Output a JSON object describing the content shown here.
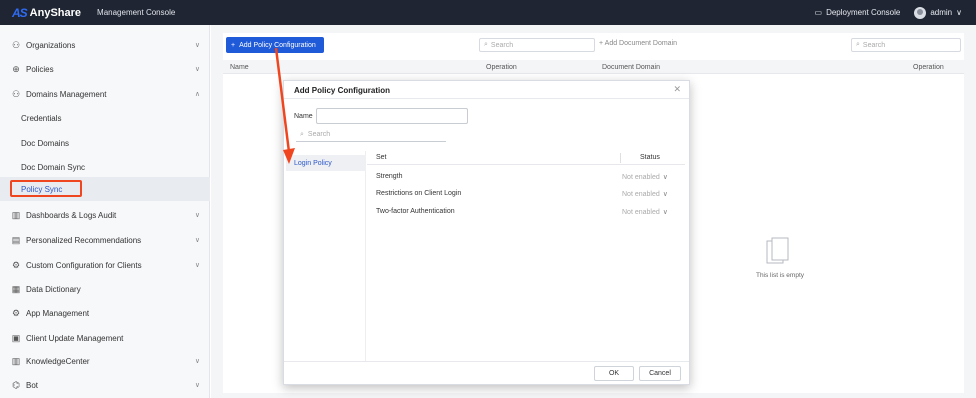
{
  "topbar": {
    "logo_mark": "AS",
    "logo_text": "AnyShare",
    "title": "Management Console",
    "deployment": "Deployment Console",
    "user": "admin"
  },
  "sidebar": {
    "items": [
      {
        "label": "Organizations",
        "icon": "org-icon",
        "chevron": "∨"
      },
      {
        "label": "Policies",
        "icon": "policy-icon",
        "chevron": "∨"
      },
      {
        "label": "Domains Management",
        "icon": "domains-icon",
        "chevron": "∧"
      },
      {
        "label": "Credentials"
      },
      {
        "label": "Doc Domains"
      },
      {
        "label": "Doc Domain Sync"
      },
      {
        "label": "Policy Sync"
      },
      {
        "label": "Dashboards & Logs Audit",
        "icon": "dashboard-icon",
        "chevron": "∨"
      },
      {
        "label": "Personalized Recommendations",
        "icon": "recommend-icon",
        "chevron": "∨"
      },
      {
        "label": "Custom Configuration for Clients",
        "icon": "custom-icon",
        "chevron": "∨"
      },
      {
        "label": "Data Dictionary",
        "icon": "dictionary-icon"
      },
      {
        "label": "App Management",
        "icon": "app-icon"
      },
      {
        "label": "Client Update Management",
        "icon": "update-icon"
      },
      {
        "label": "KnowledgeCenter",
        "icon": "knowledge-icon",
        "chevron": "∨"
      },
      {
        "label": "Bot",
        "icon": "bot-icon",
        "chevron": "∨"
      }
    ]
  },
  "main": {
    "add_policy_button": "Add Policy Configuration",
    "search_placeholder": "Search",
    "add_domain": "Add Document Domain",
    "left_columns": [
      "Name",
      "Operation"
    ],
    "right_columns": [
      "Document Domain",
      "Operation"
    ],
    "empty_text": "This list is empty"
  },
  "dialog": {
    "title": "Add Policy Configuration",
    "name_label": "Name",
    "name_value": "",
    "search_placeholder": "Search",
    "side_item": "Login Policy",
    "columns": [
      "Set",
      "Status"
    ],
    "rows": [
      {
        "set": "Strength",
        "status": "Not enabled"
      },
      {
        "set": "Restrictions on Client Login",
        "status": "Not enabled"
      },
      {
        "set": "Two-factor Authentication",
        "status": "Not enabled"
      }
    ],
    "ok": "OK",
    "cancel": "Cancel"
  },
  "colors": {
    "topbar": "#1f2532",
    "primary": "#1f5ad8",
    "highlight": "#f0461f"
  }
}
